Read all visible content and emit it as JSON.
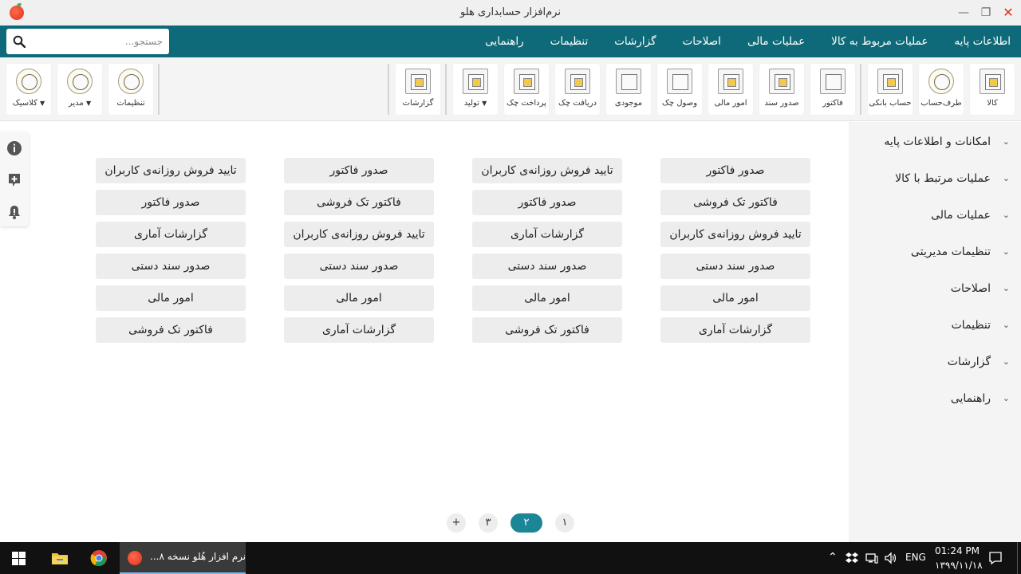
{
  "window": {
    "title": "نرم‌افزار حسابداری هلو"
  },
  "menu": [
    "اطلاعات پایه",
    "عملیات مربوط به کالا",
    "عملیات مالی",
    "اصلاحات",
    "گزارشات",
    "تنظیمات",
    "راهنمایی"
  ],
  "search": {
    "placeholder": "جستجو..."
  },
  "toolbar": {
    "main": [
      "کالا",
      "طرف‌حساب",
      "حساب بانکی",
      "فاکتور",
      "صدور سند",
      "امور مالی",
      "وصول چک",
      "موجودی",
      "دریافت چک",
      "پرداخت چک",
      "تولید",
      "گزارشات"
    ],
    "settings": [
      "تنظیمات",
      "مدیر",
      "کلاسیک"
    ]
  },
  "sidebar": [
    "امکانات و اطلاعات پایه",
    "عملیات مرتبط با کالا",
    "عملیات مالی",
    "تنظیمات مدیریتی",
    "اصلاحات",
    "تنظیمات",
    "گزارشات",
    "راهنمایی"
  ],
  "grid": [
    [
      "صدور فاکتور",
      "تایید فروش روزانه‌ی کاربران",
      "صدور فاکتور",
      "تایید فروش روزانه‌ی کاربران"
    ],
    [
      "فاکتور تک فروشی",
      "صدور فاکتور",
      "فاکتور تک فروشی",
      "صدور فاکتور"
    ],
    [
      "تایید فروش روزانه‌ی کاربران",
      "گزارشات آماری",
      "تایید فروش روزانه‌ی کاربران",
      "گزارشات آماری"
    ],
    [
      "صدور سند دستی",
      "صدور سند دستی",
      "صدور سند دستی",
      "صدور سند دستی"
    ],
    [
      "امور مالی",
      "امور مالی",
      "امور مالی",
      "امور مالی"
    ],
    [
      "گزارشات آماری",
      "فاکتور تک فروشی",
      "گزارشات آماری",
      "فاکتور تک فروشی"
    ]
  ],
  "pagination": {
    "pages": [
      "۱",
      "۲",
      "۳",
      "+"
    ],
    "active": "۲"
  },
  "taskbar": {
    "active_app": "...نرم افزار هُلو نسخه ۸",
    "lang": "ENG",
    "time": "01:24 PM",
    "date": "۱۳۹۹/۱۱/۱۸"
  },
  "colors": {
    "menubar": "#0e6a78",
    "accent": "#1a8696"
  }
}
